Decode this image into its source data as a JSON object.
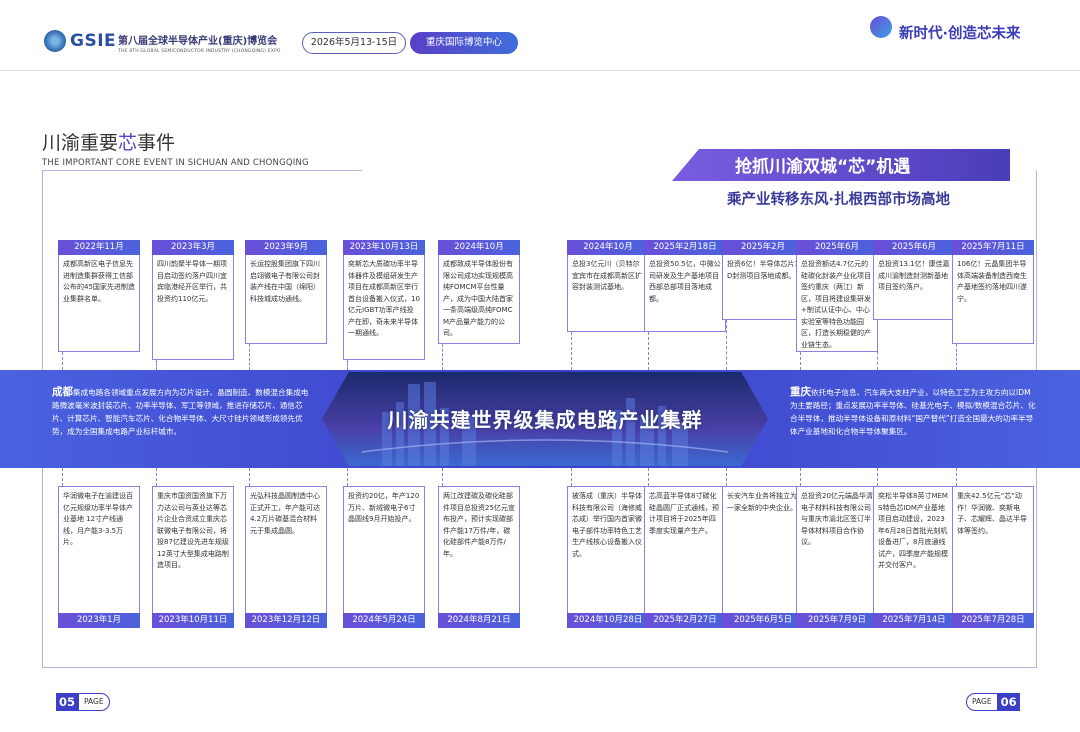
{
  "header": {
    "logo_text": "GSIE",
    "expo_cn": "第八届全球半导体产业(重庆)博览会",
    "expo_en": "THE 8TH GLOBAL SEMICONDUCTOR INDUSTRY (CHONGQING) EXPO",
    "date": "2026年5月13-15日",
    "venue": "重庆国际博览中心",
    "slogan": "新时代·创造芯未来"
  },
  "section": {
    "title_pre": "川渝重要",
    "title_hl": "芯",
    "title_post": "事件",
    "title_en": "THE IMPORTANT CORE EVENT IN SICHUAN AND CHONGQING"
  },
  "headline": {
    "main": "抢抓川渝双城“芯”机遇",
    "sub": "乘产业转移东风·扎根西部市场高地"
  },
  "band": {
    "title": "川渝共建世界级集成电路产业集群",
    "left_city": "成都",
    "left_text": "集成电路各领域重点发展方向为芯片设计、晶圆制造、数模混合集成电路微波毫米波封装芯片、功率半导体、军工等领域，推进存储芯片、通信芯片、计算芯片、智能汽车芯片、化合物半导体、大尺寸硅片领域形成领先优势，成为全国集成电路产业标杆城市。",
    "right_city": "重庆",
    "right_text": "依托电子信息、汽车两大支柱产业，以特色工艺为主攻方向以IDM为主要路径；重点发展功率半导体、硅基光电子、模拟/数模混合芯片、化合半导体，推动半导体设备和原材料“国产替代”打造全国最大的功率半导体产业基地和化合物半导体聚集区。"
  },
  "top_events": [
    {
      "date": "2022年11月",
      "text": "成都高新区电子信息先进制造集群获得工信部公布的45国家先进制造业集群名单。"
    },
    {
      "date": "2023年3月",
      "text": "四川韵聚半导体一期项目启动签约落户四川宜宾临港经开区举行，共投资约110亿元。"
    },
    {
      "date": "2023年9月",
      "text": "长运控股集团旗下四川启翊微电子有限公司封装产线在中国（绵阳）科技城成功通线。"
    },
    {
      "date": "2023年10月13日",
      "text": "奕斯芯大质碳功率半导体器件及模组研发生产项目在成都高新区举行首台设备搬入仪式，10亿元IGBT功率产线投产在即，奇未来半导体一期通线。"
    },
    {
      "date": "2024年10月",
      "text": "成都致成半导体股份有限公司成功实现规模高纯FOMCM平台性量产，成为中国大陆首家一条高端级高纯FOMCM产品量产能力的公司。"
    },
    {
      "date": "2024年10月",
      "text": "总投3亿元川（贝特尔宜宾市在成都高新区扩容封装测试基地。"
    },
    {
      "date": "2025年2月18日",
      "text": "总投资50.5亿，中微公司研发及生产基地项目西部总部项目落地成都。"
    },
    {
      "date": "2025年2月",
      "text": "投资6亿！半导体芯片3D封测项目落地成都。"
    },
    {
      "date": "2025年6月",
      "text": "总投资额达4.7亿元的硅碳化封装产业化项目签约重庆（两江）新区，项目将建设集研发+制试认证中心、中心实验室等特色功能园区，打造长期稳健的产业链生态。"
    },
    {
      "date": "2025年6月",
      "text": "总投资13.1亿！康佳嘉成川渝制造封测新基地项目签约落户。"
    },
    {
      "date": "2025年7月11日",
      "text": "106亿！元晶集团半导体高端装备制造西南生产基地签约落地四川遂宁。"
    }
  ],
  "bottom_events": [
    {
      "date": "2023年1月",
      "text": "华润微电子在渝建设百亿元规级功率半导体产业基地 12寸产线通线，月产能3-3.5万片。"
    },
    {
      "date": "2023年10月11日",
      "text": "重庆市国资国资旗下万力达公司与英业达等芯片企业合资成立重庆芯联微电子有限公司，将投87亿建设先进车规级12英寸大型集成电路制造项目。"
    },
    {
      "date": "2023年12月12日",
      "text": "光弘科技晶圆制造中心正式开工，年产能可达4.2万片碳基混合材料元于集成晶圆。"
    },
    {
      "date": "2024年5月24日",
      "text": "投资约20亿，年产120万片、新绒微电子6寸晶圆线9月开始投产。"
    },
    {
      "date": "2024年8月21日",
      "text": "两江改建碳及碳化硅部件项目总投资25亿元宣布投产，预计实现碳部件产能17万件/年，碳化硅部件产能8万件/年。"
    },
    {
      "date": "2024年10月28日",
      "text": "被落成（重庆）半导体科技有限公司（海修威芯成）举行国内首家微电子部件功率特色工艺生产线核心设备搬入仪式。"
    },
    {
      "date": "2025年2月27日",
      "text": "芯高蓝半导体8寸碳化硅晶圆厂正式通线，预计项目将于2025年四季度实现量产生产。"
    },
    {
      "date": "2025年6月5日",
      "text": "长安汽车业务将独立为一家全新的中央企业。"
    },
    {
      "date": "2025年7月9日",
      "text": "总投资20亿元端晶华清电子材料科技有限公司与重庆市渝北区签订半导体材料项目合作协议。"
    },
    {
      "date": "2025年7月14日",
      "text": "奕松半导体8英寸MEMS特色芯IDM产业基地项目启动建设，2023年6月28日首批光刻机设备进厂，8月底通线试产，四季度产能规模并交付客户。"
    },
    {
      "date": "2025年7月28日",
      "text": "重庆42.5亿元“芯”动作！华润微、奕斯电子、芯耀辉、晶达半导体等签约。"
    }
  ],
  "footer": {
    "left_num": "05",
    "left_label": "PAGE",
    "right_num": "06",
    "right_label": "PAGE"
  }
}
